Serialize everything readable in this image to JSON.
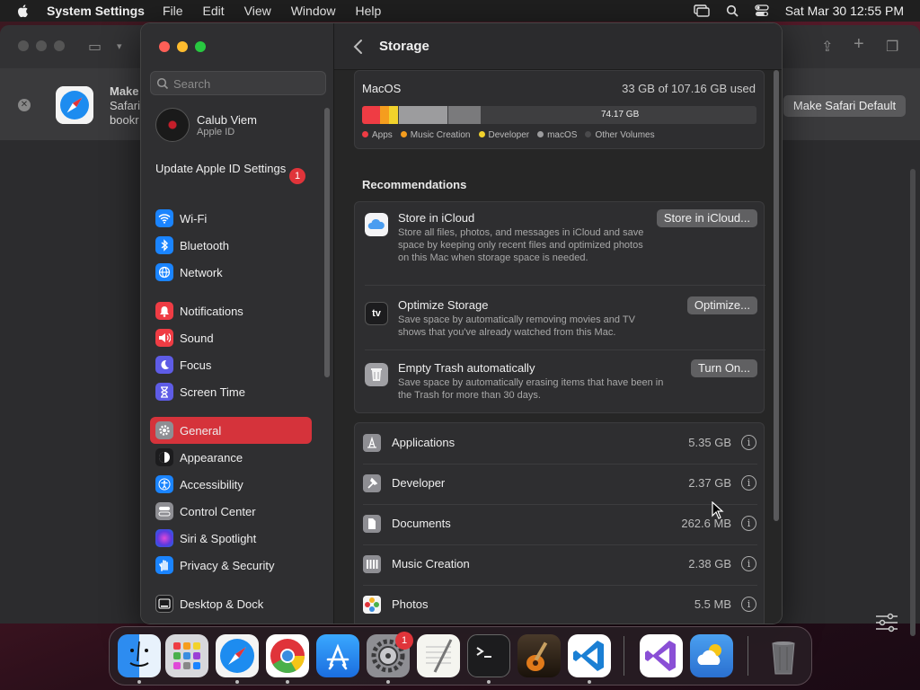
{
  "menubar": {
    "app_name": "System Settings",
    "menus": [
      "File",
      "Edit",
      "View",
      "Window",
      "Help"
    ],
    "clock": "Sat Mar 30  12:55 PM"
  },
  "safari": {
    "banner_title": "Make",
    "banner_line2": "Safari",
    "banner_line3": "bookr",
    "default_button": "Make Safari Default"
  },
  "sidebar": {
    "search_placeholder": "Search",
    "account": {
      "name": "Calub Viem",
      "subtitle": "Apple ID"
    },
    "update": {
      "label": "Update Apple ID Settings",
      "badge": "1"
    },
    "groups": [
      [
        {
          "label": "Wi-Fi",
          "icon": "wifi-icon",
          "color": "#1a84ff"
        },
        {
          "label": "Bluetooth",
          "icon": "bluetooth-icon",
          "color": "#1a84ff"
        },
        {
          "label": "Network",
          "icon": "globe-icon",
          "color": "#1a84ff"
        }
      ],
      [
        {
          "label": "Notifications",
          "icon": "bell-icon",
          "color": "#ef3c44"
        },
        {
          "label": "Sound",
          "icon": "speaker-icon",
          "color": "#ef3c44"
        },
        {
          "label": "Focus",
          "icon": "moon-icon",
          "color": "#5e5ce6"
        },
        {
          "label": "Screen Time",
          "icon": "hourglass-icon",
          "color": "#5e5ce6"
        }
      ],
      [
        {
          "label": "General",
          "icon": "gear-icon",
          "color": "#8e8e93",
          "selected": true
        },
        {
          "label": "Appearance",
          "icon": "appearance-icon",
          "color": "#1c1c1e"
        },
        {
          "label": "Accessibility",
          "icon": "accessibility-icon",
          "color": "#1a84ff"
        },
        {
          "label": "Control Center",
          "icon": "control-center-icon",
          "color": "#8e8e93"
        },
        {
          "label": "Siri & Spotlight",
          "icon": "siri-icon",
          "color": "#9b3fd6"
        },
        {
          "label": "Privacy & Security",
          "icon": "hand-icon",
          "color": "#1a84ff"
        }
      ],
      [
        {
          "label": "Desktop & Dock",
          "icon": "dock-icon",
          "color": "#1c1c1e"
        }
      ]
    ]
  },
  "main": {
    "title": "Storage",
    "volume": {
      "name": "MacOS",
      "used": "33 GB of 107.16 GB used",
      "free_label": "74.17 GB",
      "legend": [
        {
          "label": "Apps",
          "color": "#ef3c44"
        },
        {
          "label": "Music Creation",
          "color": "#f59d1e"
        },
        {
          "label": "Developer",
          "color": "#f2d22c"
        },
        {
          "label": "macOS",
          "color": "#9c9c9e"
        },
        {
          "label": "Other Volumes",
          "color": "#4a4a4c"
        }
      ]
    },
    "recommendations_title": "Recommendations",
    "recommendations": [
      {
        "title": "Store in iCloud",
        "desc": "Store all files, photos, and messages in iCloud and save space by keeping only recent files and optimized photos on this Mac when storage space is needed.",
        "button": "Store in iCloud...",
        "icon": "icloud-icon"
      },
      {
        "title": "Optimize Storage",
        "desc": "Save space by automatically removing movies and TV shows that you've already watched from this Mac.",
        "button": "Optimize...",
        "icon": "appletv-icon",
        "icon_text": "tv"
      },
      {
        "title": "Empty Trash automatically",
        "desc": "Save space by automatically erasing items that have been in the Trash for more than 30 days.",
        "button": "Turn On...",
        "icon": "trash-icon"
      }
    ],
    "categories": [
      {
        "name": "Applications",
        "size": "5.35 GB",
        "icon": "applications-icon"
      },
      {
        "name": "Developer",
        "size": "2.37 GB",
        "icon": "hammer-icon"
      },
      {
        "name": "Documents",
        "size": "262.6 MB",
        "icon": "document-icon"
      },
      {
        "name": "Music Creation",
        "size": "2.38 GB",
        "icon": "music-creation-icon"
      },
      {
        "name": "Photos",
        "size": "5.5 MB",
        "icon": "photos-icon"
      }
    ]
  },
  "dock": {
    "settings_badge": "1",
    "apps": [
      {
        "name": "finder-icon",
        "color": "#2d8cf0"
      },
      {
        "name": "launchpad-icon",
        "color": "#d8d8dc"
      },
      {
        "name": "safari-icon",
        "color": "#f4f4f4"
      },
      {
        "name": "chrome-icon",
        "color": "#ffffff"
      },
      {
        "name": "app-store-icon",
        "color": "#1c8cf5"
      },
      {
        "name": "system-settings-icon",
        "color": "#8e8e93"
      },
      {
        "name": "textedit-icon",
        "color": "#f5f5f0"
      },
      {
        "name": "terminal-icon",
        "color": "#1c1c1e"
      },
      {
        "name": "garageband-icon",
        "color": "#3a2a1a"
      },
      {
        "name": "vscode-icon",
        "color": "#ffffff"
      },
      {
        "name": "visual-studio-icon",
        "color": "#ffffff"
      },
      {
        "name": "weather-icon",
        "color": "#3a8de0"
      },
      {
        "name": "trash-dock-icon",
        "color": "#6a6a6e"
      }
    ]
  }
}
